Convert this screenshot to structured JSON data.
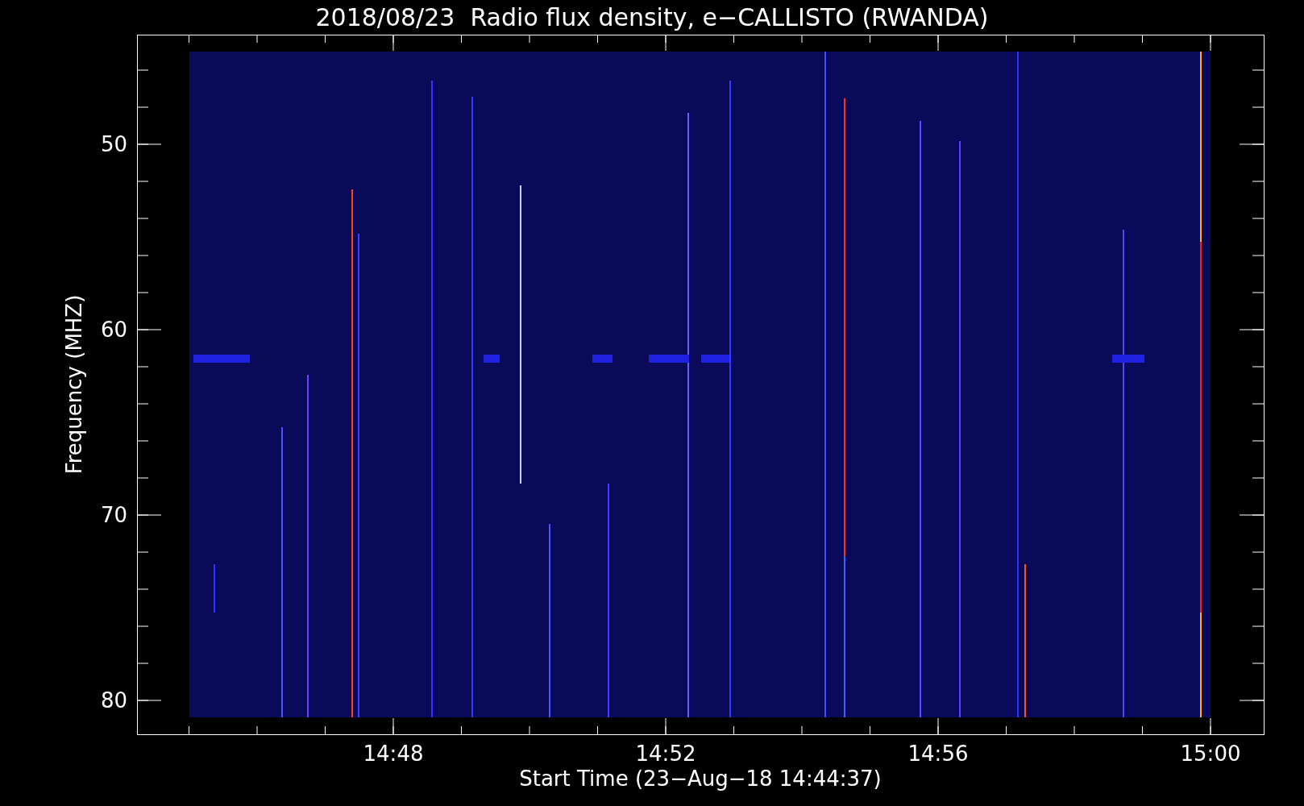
{
  "title": "2018/08/23  Radio flux density, e−CALLISTO (RWANDA)",
  "y_axis": {
    "label": "Frequency (MHZ)",
    "ticks": [
      "50",
      "60",
      "70",
      "80"
    ]
  },
  "x_axis": {
    "label": "Start Time (23−Aug−18 14:44:37)",
    "ticks": [
      "14:48",
      "14:52",
      "14:56",
      "15:00"
    ]
  }
}
